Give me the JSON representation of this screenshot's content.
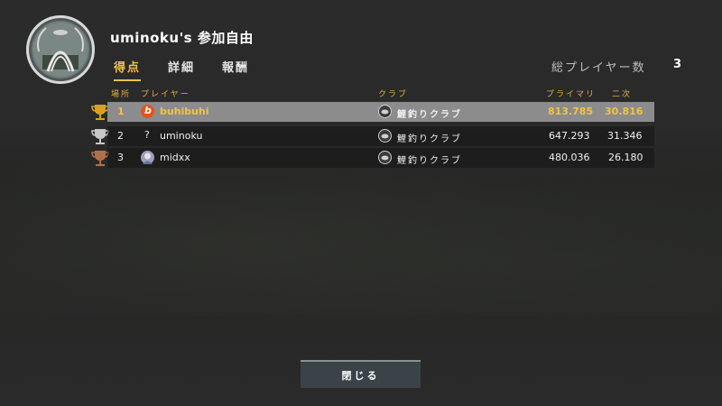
{
  "header": {
    "title": "uminoku's 参加自由",
    "emblem_icon": "fishing-club-emblem-icon"
  },
  "tabs": [
    {
      "label": "得点",
      "active": true
    },
    {
      "label": "詳細",
      "active": false
    },
    {
      "label": "報酬",
      "active": false
    }
  ],
  "total_players": {
    "label": "総プレイヤー数",
    "value": "3"
  },
  "columns": {
    "place": "場所",
    "player": "プレイヤー",
    "club": "クラブ",
    "primary": "プライマリ",
    "secondary": "二次"
  },
  "rows": [
    {
      "place": "1",
      "player": "buhibuhi",
      "club": "鯉釣りクラブ",
      "primary": "813.785",
      "secondary": "30.816",
      "trophy": "gold",
      "avatar": "orange-b-avatar",
      "highlight": true
    },
    {
      "place": "2",
      "player": "uminoku",
      "club": "鯉釣りクラブ",
      "primary": "647.293",
      "secondary": "31.346",
      "trophy": "silver",
      "avatar": "question-avatar",
      "highlight": false
    },
    {
      "place": "3",
      "player": "midxx",
      "club": "鯉釣りクラブ",
      "primary": "480.036",
      "secondary": "26.180",
      "trophy": "bronze",
      "avatar": "anime-avatar",
      "highlight": false
    }
  ],
  "row0_avatar_letter": "b",
  "row1_avatar_glyph": "?",
  "close_button": "閉じる",
  "colors": {
    "accent": "#f0c24a",
    "gold": "#d9a21b",
    "silver": "#c8c8c8",
    "bronze": "#b0704a"
  }
}
